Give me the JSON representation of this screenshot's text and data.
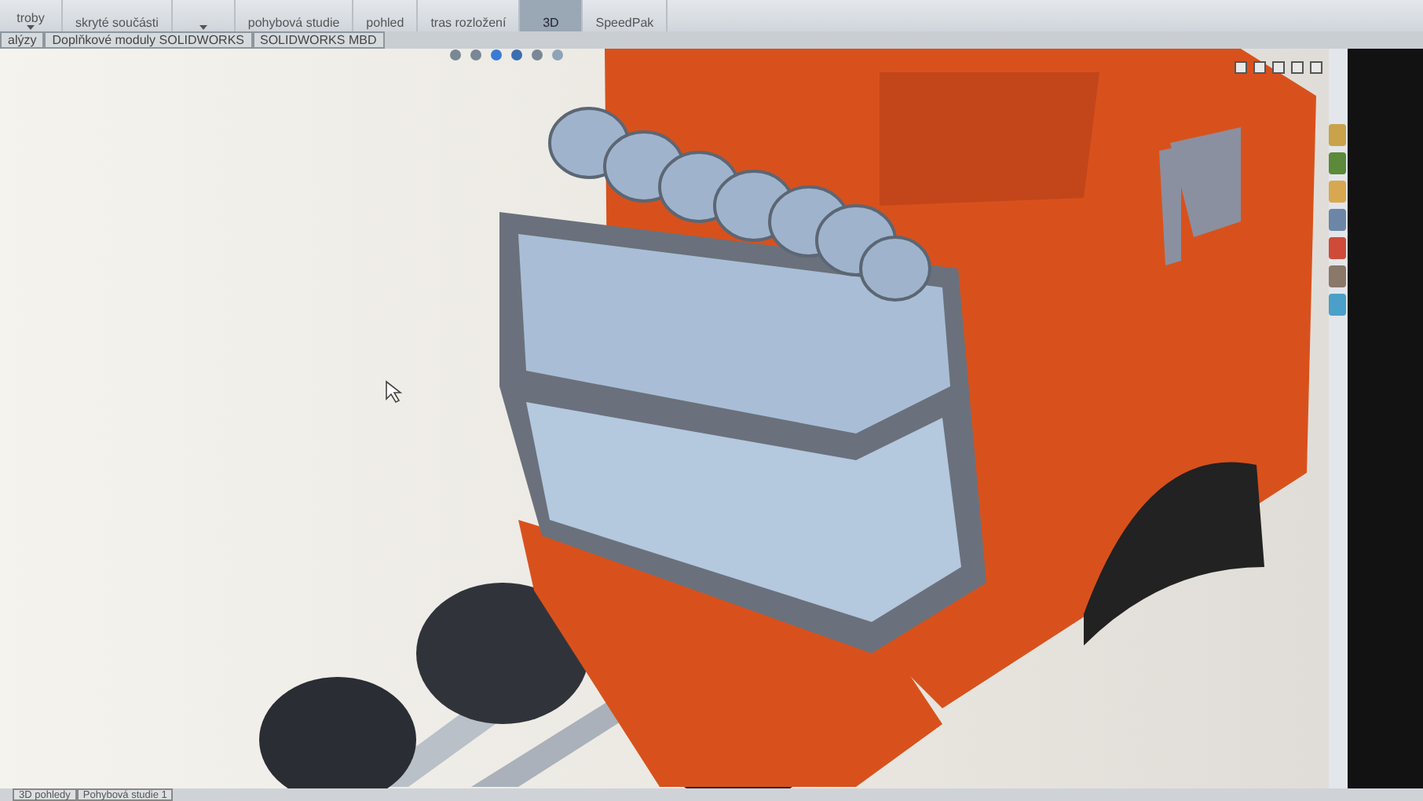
{
  "ribbon": {
    "buttons": [
      {
        "label": "troby",
        "caret": true,
        "selected": false
      },
      {
        "label": "skryté součásti",
        "caret": false,
        "selected": false
      },
      {
        "caret": true,
        "selected": false
      },
      {
        "label": "pohybová studie",
        "caret": false,
        "selected": false
      },
      {
        "label": "pohled",
        "caret": false,
        "selected": false
      },
      {
        "label": "tras rozložení",
        "caret": false,
        "selected": false
      },
      {
        "label": "3D",
        "caret": false,
        "selected": true
      },
      {
        "label": "SpeedPak",
        "caret": false,
        "selected": false
      }
    ]
  },
  "command_tabs": [
    {
      "label": "alýzy",
      "selected": false
    },
    {
      "label": "Doplňkové moduly SOLIDWORKS",
      "selected": false
    },
    {
      "label": "SOLIDWORKS MBD",
      "selected": false
    }
  ],
  "bottom_tabs": [
    {
      "label": "3D pohledy",
      "selected": false
    },
    {
      "label": "Pohybová studie 1",
      "selected": false
    }
  ]
}
